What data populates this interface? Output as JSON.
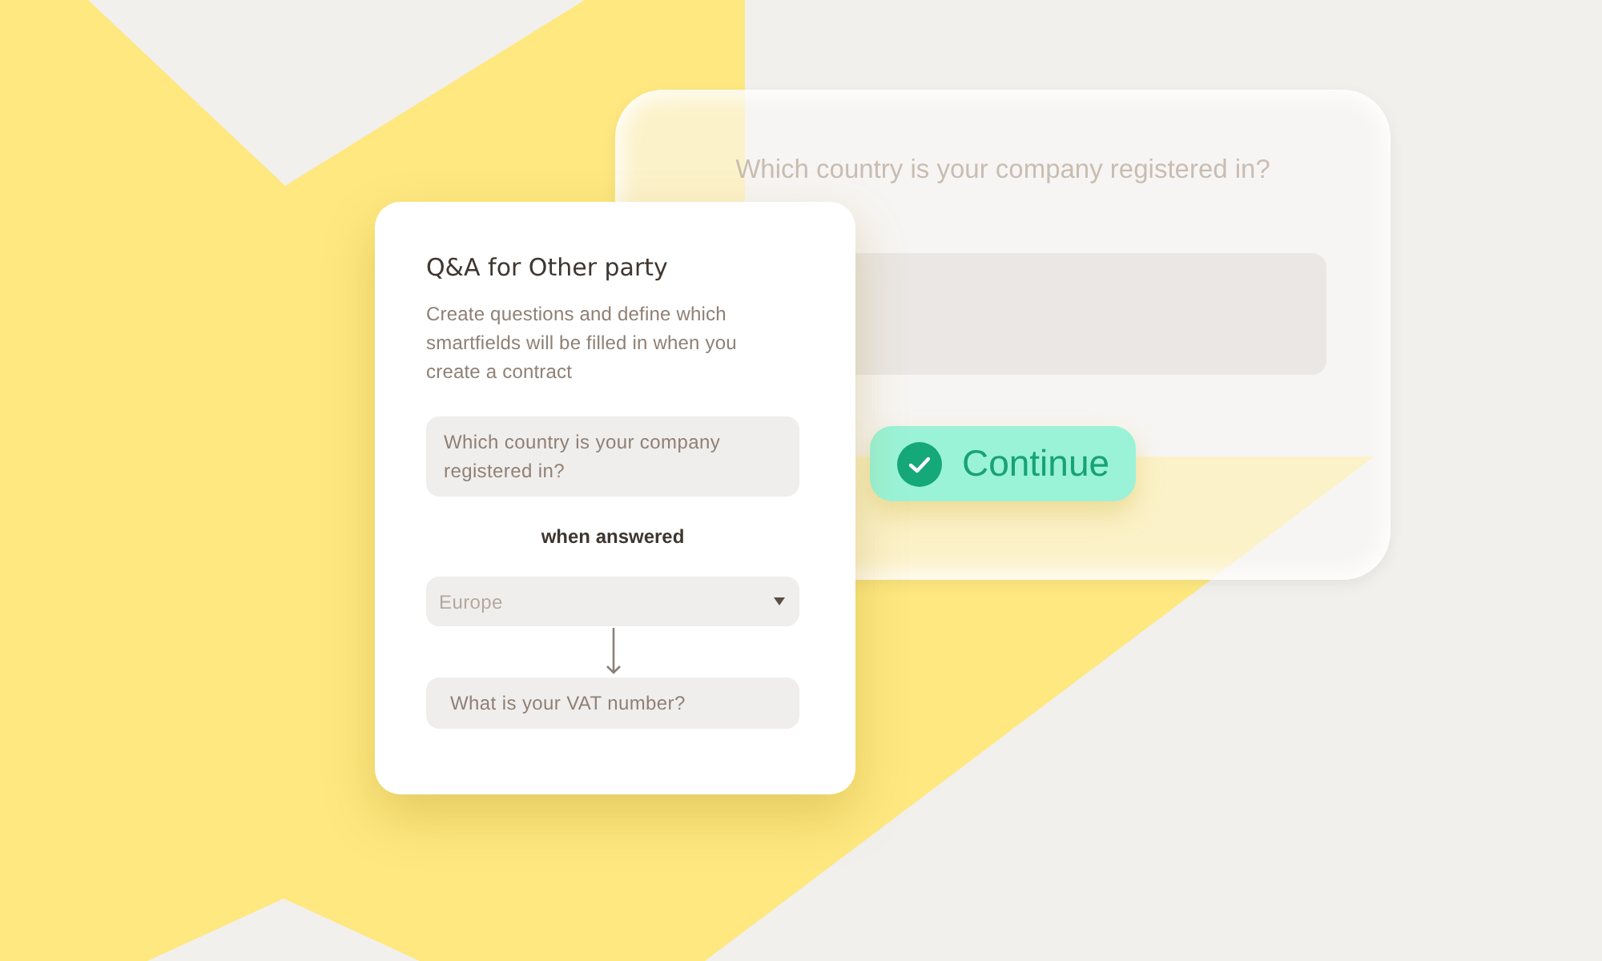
{
  "background_card": {
    "question": "Which country is your company registered in?",
    "continue_button": {
      "label": "Continue"
    }
  },
  "qa_card": {
    "title": "Q&A for Other party",
    "description": "Create questions and define which smartfields will be filled in when you create a contract",
    "question_field": {
      "value": "Which country is your company registered in?"
    },
    "condition_label": "when answered",
    "answer_dropdown": {
      "placeholder": "Europe"
    },
    "target_field": {
      "value": "What is your VAT number?"
    }
  }
}
